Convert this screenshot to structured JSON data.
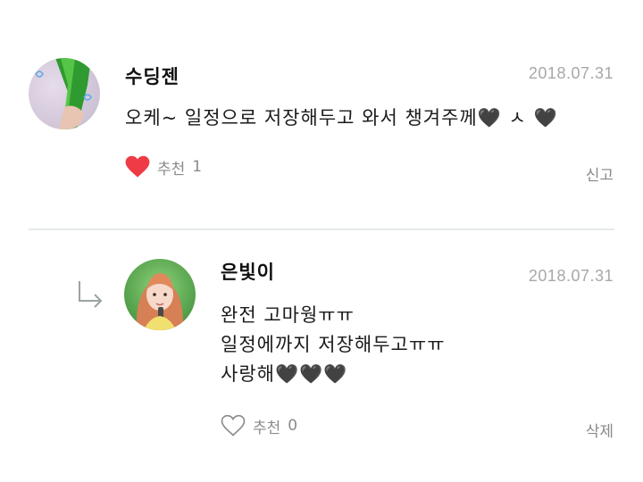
{
  "comments": [
    {
      "author": "수딩젠",
      "date": "2018.07.31",
      "lines": [
        "오케~ 일정으로 저장해두고 와서 챙겨주께🖤 ㅅ 🖤"
      ],
      "like_label": "추천",
      "like_count": "1",
      "liked": true,
      "action_label": "신고"
    },
    {
      "author": "은빛이",
      "date": "2018.07.31",
      "lines": [
        "완전 고마웡ㅠㅠ",
        "일정에까지 저장해두고ㅠㅠ",
        "사랑해🖤🖤🖤"
      ],
      "like_label": "추천",
      "like_count": "0",
      "liked": false,
      "action_label": "삭제"
    }
  ],
  "colors": {
    "liked_heart": "#ef3b46",
    "divider": "#e3eae7",
    "meta_text": "#8a8a8a",
    "date_text": "#a8a8a8"
  },
  "icons": {
    "reply": "reply-arrow-icon",
    "like_filled": "heart-filled-icon",
    "like_outline": "heart-outline-icon"
  }
}
